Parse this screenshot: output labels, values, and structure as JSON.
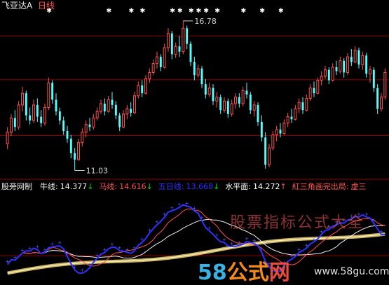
{
  "header": {
    "security_name": "飞亚达A",
    "period": "日线",
    "star_glyph": "✱",
    "up_arrow": "↓",
    "sparkle_glyph": "◆"
  },
  "chart_data": [
    {
      "type": "candlestick",
      "title": "",
      "annotations": [
        {
          "text": "16.78",
          "kind": "high"
        },
        {
          "text": "11.03",
          "kind": "low"
        }
      ],
      "ylim": [
        10.8,
        17.1
      ],
      "grid_levels": [
        12.38,
        14.52,
        16.2
      ],
      "colors": {
        "up": "#ff5050",
        "down": "#54fcfc",
        "grid": "#8b0000"
      },
      "candles": [
        {
          "o": 12.05,
          "h": 12.7,
          "l": 11.85,
          "c": 12.5
        },
        {
          "o": 12.5,
          "h": 13.2,
          "l": 12.35,
          "c": 13.05
        },
        {
          "o": 13.05,
          "h": 13.35,
          "l": 12.55,
          "c": 12.7
        },
        {
          "o": 12.7,
          "h": 13.7,
          "l": 12.6,
          "c": 13.55
        },
        {
          "o": 13.55,
          "h": 14.25,
          "l": 13.3,
          "c": 14.0
        },
        {
          "o": 14.0,
          "h": 14.1,
          "l": 12.95,
          "c": 13.15
        },
        {
          "o": 13.15,
          "h": 13.45,
          "l": 12.8,
          "c": 12.95
        },
        {
          "o": 12.95,
          "h": 13.75,
          "l": 12.85,
          "c": 13.55
        },
        {
          "o": 13.55,
          "h": 13.8,
          "l": 12.9,
          "c": 13.1
        },
        {
          "o": 13.1,
          "h": 13.35,
          "l": 12.7,
          "c": 12.85
        },
        {
          "o": 12.85,
          "h": 13.6,
          "l": 12.75,
          "c": 13.45
        },
        {
          "o": 13.45,
          "h": 14.6,
          "l": 13.35,
          "c": 14.4
        },
        {
          "o": 14.4,
          "h": 14.5,
          "l": 13.6,
          "c": 13.75
        },
        {
          "o": 13.75,
          "h": 14.0,
          "l": 13.15,
          "c": 13.3
        },
        {
          "o": 13.3,
          "h": 13.45,
          "l": 12.8,
          "c": 12.95
        },
        {
          "o": 12.95,
          "h": 13.1,
          "l": 12.4,
          "c": 12.55
        },
        {
          "o": 12.55,
          "h": 12.75,
          "l": 12.1,
          "c": 12.25
        },
        {
          "o": 12.25,
          "h": 12.4,
          "l": 11.5,
          "c": 11.7
        },
        {
          "o": 11.7,
          "h": 11.9,
          "l": 11.03,
          "c": 11.45
        },
        {
          "o": 11.45,
          "h": 12.25,
          "l": 11.4,
          "c": 12.1
        },
        {
          "o": 12.1,
          "h": 12.65,
          "l": 11.95,
          "c": 12.5
        },
        {
          "o": 12.5,
          "h": 12.95,
          "l": 12.3,
          "c": 12.8
        },
        {
          "o": 12.8,
          "h": 13.05,
          "l": 12.55,
          "c": 12.7
        },
        {
          "o": 12.7,
          "h": 13.2,
          "l": 12.6,
          "c": 13.05
        },
        {
          "o": 13.05,
          "h": 13.45,
          "l": 12.95,
          "c": 13.3
        },
        {
          "o": 13.3,
          "h": 13.75,
          "l": 13.2,
          "c": 13.6
        },
        {
          "o": 13.6,
          "h": 13.8,
          "l": 13.15,
          "c": 13.3
        },
        {
          "o": 13.3,
          "h": 13.9,
          "l": 13.25,
          "c": 13.75
        },
        {
          "o": 13.75,
          "h": 14.05,
          "l": 13.4,
          "c": 13.55
        },
        {
          "o": 13.55,
          "h": 13.7,
          "l": 13.0,
          "c": 13.15
        },
        {
          "o": 13.15,
          "h": 13.25,
          "l": 12.55,
          "c": 12.7
        },
        {
          "o": 12.7,
          "h": 13.35,
          "l": 12.65,
          "c": 13.2
        },
        {
          "o": 13.2,
          "h": 13.55,
          "l": 13.0,
          "c": 13.4
        },
        {
          "o": 13.4,
          "h": 13.65,
          "l": 13.1,
          "c": 13.25
        },
        {
          "o": 13.25,
          "h": 14.05,
          "l": 13.2,
          "c": 13.9
        },
        {
          "o": 13.9,
          "h": 14.45,
          "l": 13.8,
          "c": 14.3
        },
        {
          "o": 14.3,
          "h": 14.5,
          "l": 13.85,
          "c": 14.0
        },
        {
          "o": 14.0,
          "h": 14.7,
          "l": 13.95,
          "c": 14.55
        },
        {
          "o": 14.55,
          "h": 14.95,
          "l": 14.4,
          "c": 14.8
        },
        {
          "o": 14.8,
          "h": 15.3,
          "l": 14.7,
          "c": 15.15
        },
        {
          "o": 15.15,
          "h": 15.6,
          "l": 14.95,
          "c": 15.4
        },
        {
          "o": 15.4,
          "h": 15.5,
          "l": 14.85,
          "c": 15.0
        },
        {
          "o": 15.0,
          "h": 15.9,
          "l": 14.95,
          "c": 15.75
        },
        {
          "o": 15.75,
          "h": 16.5,
          "l": 15.6,
          "c": 16.3
        },
        {
          "o": 16.3,
          "h": 16.4,
          "l": 15.3,
          "c": 15.5
        },
        {
          "o": 15.5,
          "h": 15.95,
          "l": 15.35,
          "c": 15.8
        },
        {
          "o": 15.8,
          "h": 16.2,
          "l": 15.4,
          "c": 15.6
        },
        {
          "o": 15.6,
          "h": 16.78,
          "l": 15.5,
          "c": 16.5
        },
        {
          "o": 16.5,
          "h": 16.6,
          "l": 15.7,
          "c": 15.9
        },
        {
          "o": 15.9,
          "h": 16.0,
          "l": 15.05,
          "c": 15.2
        },
        {
          "o": 15.2,
          "h": 15.4,
          "l": 14.5,
          "c": 14.7
        },
        {
          "o": 14.7,
          "h": 15.1,
          "l": 14.6,
          "c": 14.95
        },
        {
          "o": 14.95,
          "h": 15.05,
          "l": 14.2,
          "c": 14.35
        },
        {
          "o": 14.35,
          "h": 14.55,
          "l": 13.8,
          "c": 13.95
        },
        {
          "o": 13.95,
          "h": 14.4,
          "l": 13.85,
          "c": 14.2
        },
        {
          "o": 14.2,
          "h": 14.35,
          "l": 13.55,
          "c": 13.7
        },
        {
          "o": 13.7,
          "h": 14.05,
          "l": 13.45,
          "c": 13.85
        },
        {
          "o": 13.85,
          "h": 13.95,
          "l": 13.2,
          "c": 13.35
        },
        {
          "o": 13.35,
          "h": 13.85,
          "l": 13.25,
          "c": 13.7
        },
        {
          "o": 13.7,
          "h": 13.8,
          "l": 13.05,
          "c": 13.2
        },
        {
          "o": 13.2,
          "h": 13.75,
          "l": 13.1,
          "c": 13.6
        },
        {
          "o": 13.6,
          "h": 14.0,
          "l": 13.4,
          "c": 13.85
        },
        {
          "o": 13.85,
          "h": 14.0,
          "l": 13.45,
          "c": 13.6
        },
        {
          "o": 13.6,
          "h": 14.25,
          "l": 13.5,
          "c": 14.1
        },
        {
          "o": 14.1,
          "h": 14.4,
          "l": 13.8,
          "c": 13.95
        },
        {
          "o": 13.95,
          "h": 14.05,
          "l": 13.2,
          "c": 13.35
        },
        {
          "o": 13.35,
          "h": 13.7,
          "l": 13.1,
          "c": 13.55
        },
        {
          "o": 13.55,
          "h": 13.65,
          "l": 12.75,
          "c": 12.9
        },
        {
          "o": 12.9,
          "h": 13.15,
          "l": 12.15,
          "c": 12.3
        },
        {
          "o": 12.3,
          "h": 12.5,
          "l": 11.1,
          "c": 11.25
        },
        {
          "o": 11.25,
          "h": 12.05,
          "l": 11.15,
          "c": 11.9
        },
        {
          "o": 11.9,
          "h": 12.55,
          "l": 11.8,
          "c": 12.4
        },
        {
          "o": 12.4,
          "h": 12.75,
          "l": 12.15,
          "c": 12.6
        },
        {
          "o": 12.6,
          "h": 12.85,
          "l": 12.3,
          "c": 12.45
        },
        {
          "o": 12.45,
          "h": 13.0,
          "l": 12.4,
          "c": 12.85
        },
        {
          "o": 12.85,
          "h": 13.25,
          "l": 12.7,
          "c": 13.1
        },
        {
          "o": 13.1,
          "h": 13.4,
          "l": 12.85,
          "c": 13.0
        },
        {
          "o": 13.0,
          "h": 13.55,
          "l": 12.95,
          "c": 13.4
        },
        {
          "o": 13.4,
          "h": 13.8,
          "l": 13.25,
          "c": 13.65
        },
        {
          "o": 13.65,
          "h": 13.85,
          "l": 13.2,
          "c": 13.35
        },
        {
          "o": 13.35,
          "h": 13.95,
          "l": 13.3,
          "c": 13.8
        },
        {
          "o": 13.8,
          "h": 14.35,
          "l": 13.7,
          "c": 14.2
        },
        {
          "o": 14.2,
          "h": 14.45,
          "l": 13.85,
          "c": 14.0
        },
        {
          "o": 14.0,
          "h": 14.6,
          "l": 13.95,
          "c": 14.5
        },
        {
          "o": 14.5,
          "h": 14.85,
          "l": 14.3,
          "c": 14.65
        },
        {
          "o": 14.65,
          "h": 15.05,
          "l": 14.55,
          "c": 14.9
        },
        {
          "o": 14.9,
          "h": 15.0,
          "l": 14.35,
          "c": 14.5
        },
        {
          "o": 14.5,
          "h": 15.15,
          "l": 14.45,
          "c": 15.0
        },
        {
          "o": 15.0,
          "h": 15.25,
          "l": 14.7,
          "c": 14.85
        },
        {
          "o": 14.85,
          "h": 15.4,
          "l": 14.75,
          "c": 15.25
        },
        {
          "o": 15.25,
          "h": 15.35,
          "l": 14.6,
          "c": 14.8
        },
        {
          "o": 14.8,
          "h": 15.55,
          "l": 14.7,
          "c": 15.4
        },
        {
          "o": 15.4,
          "h": 15.7,
          "l": 15.05,
          "c": 15.2
        },
        {
          "o": 15.2,
          "h": 15.8,
          "l": 15.15,
          "c": 15.65
        },
        {
          "o": 15.65,
          "h": 15.75,
          "l": 14.95,
          "c": 15.1
        },
        {
          "o": 15.1,
          "h": 15.6,
          "l": 14.9,
          "c": 15.45
        },
        {
          "o": 15.45,
          "h": 15.55,
          "l": 14.6,
          "c": 14.75
        },
        {
          "o": 14.75,
          "h": 15.05,
          "l": 14.4,
          "c": 14.9
        },
        {
          "o": 14.9,
          "h": 15.0,
          "l": 14.05,
          "c": 14.2
        },
        {
          "o": 14.2,
          "h": 14.35,
          "l": 13.2,
          "c": 13.4
        },
        {
          "o": 13.4,
          "h": 14.0,
          "l": 13.3,
          "c": 13.85
        },
        {
          "o": 13.85,
          "h": 14.95,
          "l": 13.75,
          "c": 14.8
        }
      ]
    },
    {
      "type": "line",
      "title": "",
      "legend": [
        {
          "label": "股旁网制",
          "value": "",
          "color": "#f0f0f0"
        },
        {
          "label": "牛线:",
          "value": "14.377",
          "arrow": "↓",
          "color": "#f0f0f0"
        },
        {
          "label": "马线:",
          "value": "14.616",
          "arrow": "↓",
          "color": "#ff5050"
        },
        {
          "label": "五日线:",
          "value": "13.668",
          "arrow": "↓",
          "color": "#3030ff"
        },
        {
          "label": "水平面:",
          "value": "14.272",
          "arrow": "↑",
          "color": "#ffffff"
        },
        {
          "label": "紅三角画完出局:",
          "value": "虚三",
          "color": "#ff5050"
        }
      ],
      "series": [
        {
          "name": "牛线",
          "color": "#f0f0f0"
        },
        {
          "name": "马线",
          "color": "#ff5050"
        },
        {
          "name": "五日线",
          "color": "#3030ff"
        },
        {
          "name": "水平面",
          "color": "#f0e68c"
        }
      ]
    }
  ],
  "watermark": {
    "digits": "58",
    "brand_a": "公式",
    "brand_b": "网",
    "site": "www.58gu.com",
    "faded_text": "股票指标公式大全"
  }
}
